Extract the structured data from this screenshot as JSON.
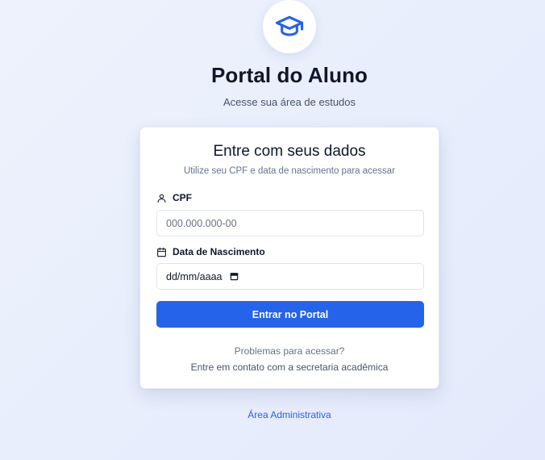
{
  "header": {
    "logo_icon": "graduation-cap-icon",
    "title": "Portal do Aluno",
    "subtitle": "Acesse sua área de estudos"
  },
  "login_card": {
    "title": "Entre com seus dados",
    "subtitle": "Utilize seu CPF e data de nascimento para acessar",
    "cpf": {
      "icon": "user-icon",
      "label": "CPF",
      "placeholder": "000.000.000-00",
      "value": ""
    },
    "birth_date": {
      "icon": "calendar-icon",
      "label": "Data de Nascimento",
      "value_display": "dd/mm/aaaa"
    },
    "submit_label": "Entrar no Portal",
    "help_title": "Problemas para acessar?",
    "help_text": "Entre em contato com a secretaria acadêmica"
  },
  "footer": {
    "admin_link": "Área Administrativa"
  },
  "colors": {
    "accent": "#2563eb",
    "background": "#e8eefc",
    "text": "#0f172a",
    "muted": "#64748b"
  }
}
